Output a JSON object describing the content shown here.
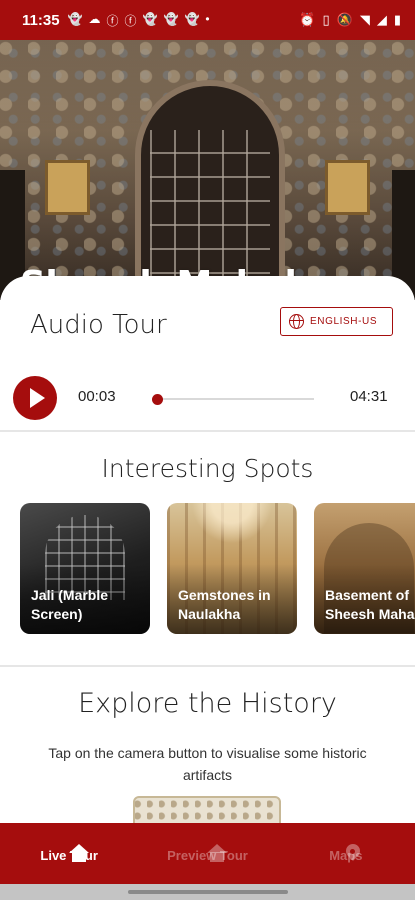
{
  "status_bar": {
    "time": "11:35",
    "left_icons": [
      "ghost-icon",
      "cloud-icon",
      "facebook-icon",
      "facebook-icon",
      "ghost-icon",
      "ghost-icon",
      "ghost-icon",
      "dot-icon"
    ],
    "right_icons": [
      "alarm-icon",
      "vibrate-icon",
      "mute-icon",
      "wifi-icon",
      "signal-icon",
      "battery-icon"
    ]
  },
  "hero": {
    "title": "Sheesh Mahal"
  },
  "audio": {
    "title": "Audio Tour",
    "language": "ENGLISH-US",
    "current_time": "00:03",
    "total_time": "04:31",
    "progress": 0.011
  },
  "spots": {
    "title": "Interesting Spots",
    "items": [
      {
        "label": "Jali (Marble\nScreen)"
      },
      {
        "label": "Gemstones in\nNaulakha"
      },
      {
        "label": "Basement of\nSheesh Mahal"
      }
    ]
  },
  "history": {
    "title": "Explore the History",
    "subtitle": "Tap on the camera button to visualise some historic artifacts"
  },
  "nav": {
    "items": [
      {
        "label": "Live Tour",
        "icon": "home-icon",
        "active": true
      },
      {
        "label": "Preview Tour",
        "icon": "home-icon",
        "active": false
      },
      {
        "label": "Maps",
        "icon": "map-pin-icon",
        "active": false
      }
    ]
  },
  "colors": {
    "accent": "#a50d0d",
    "text": "#222222",
    "divider": "#e6e6e6"
  }
}
